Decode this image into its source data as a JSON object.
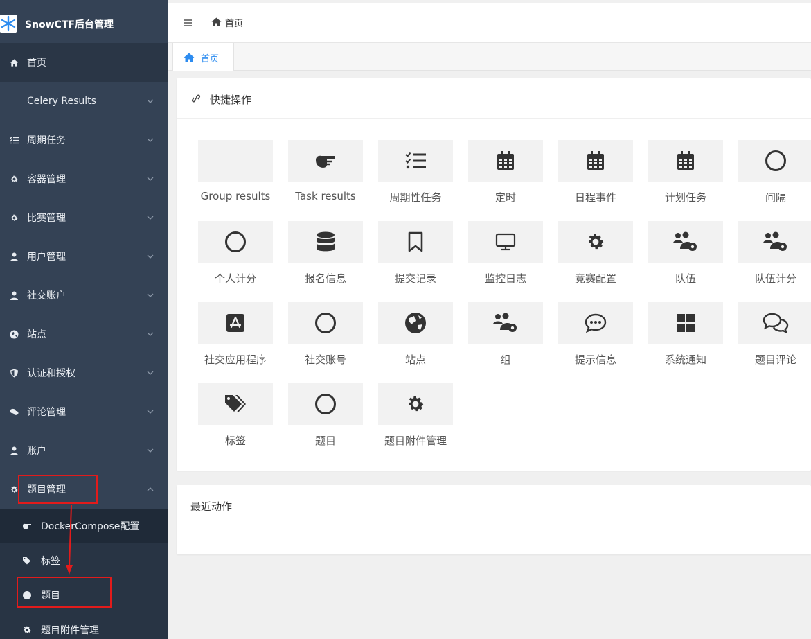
{
  "brand": {
    "title": "SnowCTF后台管理",
    "logo_icon": "snowflake-icon",
    "logo_color": "#2d8cf0"
  },
  "sidebar": {
    "items": [
      {
        "label": "首页",
        "icon": "home-icon"
      },
      {
        "label": "Celery Results",
        "icon": ""
      },
      {
        "label": "周期任务",
        "icon": "list-check-icon"
      },
      {
        "label": "容器管理",
        "icon": "gear-icon"
      },
      {
        "label": "比赛管理",
        "icon": "gear-icon"
      },
      {
        "label": "用户管理",
        "icon": "user-icon"
      },
      {
        "label": "社交账户",
        "icon": "user-icon"
      },
      {
        "label": "站点",
        "icon": "globe-icon"
      },
      {
        "label": "认证和授权",
        "icon": "shield-icon"
      },
      {
        "label": "评论管理",
        "icon": "comments-icon"
      },
      {
        "label": "账户",
        "icon": "user-icon"
      },
      {
        "label": "题目管理",
        "icon": "gear-icon"
      }
    ],
    "subitems": [
      {
        "label": "DockerCompose配置",
        "icon": "hand-point-icon"
      },
      {
        "label": "标签",
        "icon": "tags-icon"
      },
      {
        "label": "题目",
        "icon": "circle-icon"
      },
      {
        "label": "题目附件管理",
        "icon": "gear-icon"
      }
    ]
  },
  "topbar": {
    "breadcrumb": "首页"
  },
  "tabs": [
    {
      "label": "首页"
    }
  ],
  "quick": {
    "title": "快捷操作",
    "tiles": [
      {
        "label": "Group results",
        "icon": ""
      },
      {
        "label": "Task results",
        "icon": "hand-point-icon"
      },
      {
        "label": "周期性任务",
        "icon": "list-check-icon"
      },
      {
        "label": "定时",
        "icon": "calendar-icon"
      },
      {
        "label": "日程事件",
        "icon": "calendar-icon"
      },
      {
        "label": "计划任务",
        "icon": "calendar-icon"
      },
      {
        "label": "间隔",
        "icon": "circle-icon"
      },
      {
        "label": "个人计分",
        "icon": "circle-icon"
      },
      {
        "label": "报名信息",
        "icon": "database-icon"
      },
      {
        "label": "提交记录",
        "icon": "bookmark-icon"
      },
      {
        "label": "监控日志",
        "icon": "desktop-icon"
      },
      {
        "label": "竞赛配置",
        "icon": "gear-icon"
      },
      {
        "label": "队伍",
        "icon": "users-gear-icon"
      },
      {
        "label": "队伍计分",
        "icon": "users-gear-icon"
      },
      {
        "label": "社交应用程序",
        "icon": "app-store-icon"
      },
      {
        "label": "社交账号",
        "icon": "circle-icon"
      },
      {
        "label": "站点",
        "icon": "globe-icon"
      },
      {
        "label": "组",
        "icon": "users-gear-icon"
      },
      {
        "label": "提示信息",
        "icon": "comment-dots-icon"
      },
      {
        "label": "系统通知",
        "icon": "windows-icon"
      },
      {
        "label": "题目评论",
        "icon": "comments-icon"
      },
      {
        "label": "标签",
        "icon": "tags-icon"
      },
      {
        "label": "题目",
        "icon": "circle-icon"
      },
      {
        "label": "题目附件管理",
        "icon": "gear-icon"
      }
    ]
  },
  "recent": {
    "title": "最近动作"
  },
  "colors": {
    "sidebar_bg": "#344255",
    "accent": "#2d8cf0",
    "highlight": "#e21b1b"
  }
}
